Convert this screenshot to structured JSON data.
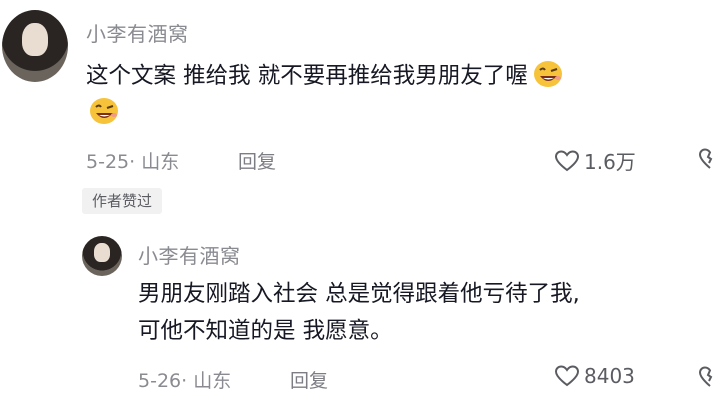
{
  "comment": {
    "author": "小李有酒窝",
    "text_line1": "这个文案 推给我 就不要再推给我男朋友了喔",
    "emoji_icon": "grinning-wink-emoji",
    "date_location": "5-25· 山东",
    "reply_label": "回复",
    "like_count": "1.6万",
    "author_liked_badge": "作者赞过"
  },
  "reply": {
    "author": "小李有酒窝",
    "text_line1": "男朋友刚踏入社会 总是觉得跟着他亏待了我,",
    "text_line2": "可他不知道的是 我愿意。",
    "date_location": "5-26· 山东",
    "reply_label": "回复",
    "like_count": "8403"
  }
}
